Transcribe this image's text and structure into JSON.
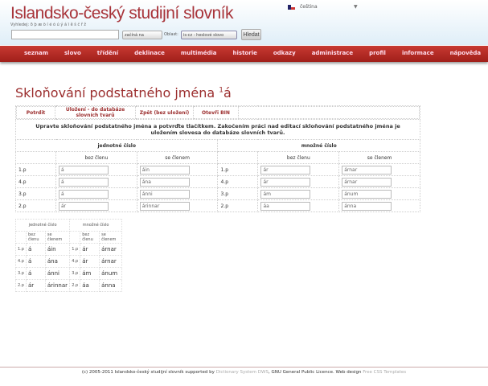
{
  "header": {
    "title": "Islandsko-český studijní slovník",
    "chars_label": "Vyhledej:",
    "chars": "ð þ æ ö í é ó ú ý á ï ě š č ř ž",
    "language": "čeština",
    "search_value": "",
    "match_mode": "začíná na",
    "area_label": "Oblast:",
    "area": "is-cz - heslové slovo",
    "search_button": "Hledat"
  },
  "nav": [
    "seznam",
    "slovo",
    "třídění",
    "deklinace",
    "multimédia",
    "historie",
    "odkazy",
    "administrace",
    "profil",
    "informace",
    "nápověda"
  ],
  "page": {
    "title": "Skloňování podstatného jména",
    "sup": "1",
    "word": "á"
  },
  "buttons": [
    "Potrdit",
    "Uložení - do databáze slovních tvarů",
    "Zpět (bez uložení)",
    "Otevři BIN"
  ],
  "instruction": "Upravte skloňování podstatného jména a potvrďte tlačítkem. Zakočením práci nad editací skloňování podstatného jména je uložením slovesa do databáze slovních tvarů.",
  "groups": [
    "jednotné číslo",
    "množné číslo"
  ],
  "subheads": [
    "bez členu",
    "se členem"
  ],
  "rows": [
    {
      "case": "1.p",
      "sg": "á",
      "sga": "áin",
      "pl": "ár",
      "pla": "árnar"
    },
    {
      "case": "4.p",
      "sg": "á",
      "sga": "ána",
      "pl": "ár",
      "pla": "árnar"
    },
    {
      "case": "3.p",
      "sg": "á",
      "sga": "ánni",
      "pl": "ám",
      "pla": "ánum"
    },
    {
      "case": "2.p",
      "sg": "ár",
      "sga": "árinnar",
      "pl": "áa",
      "pla": "ánna"
    }
  ],
  "footer": {
    "pre": "(c) 2005-2011 Islandsko-český studijní slovník supported by",
    "link1": "Dictionary System DWS",
    "mid": ", GNU General Public Licence. Web design",
    "link2": "Free CSS Templates"
  }
}
